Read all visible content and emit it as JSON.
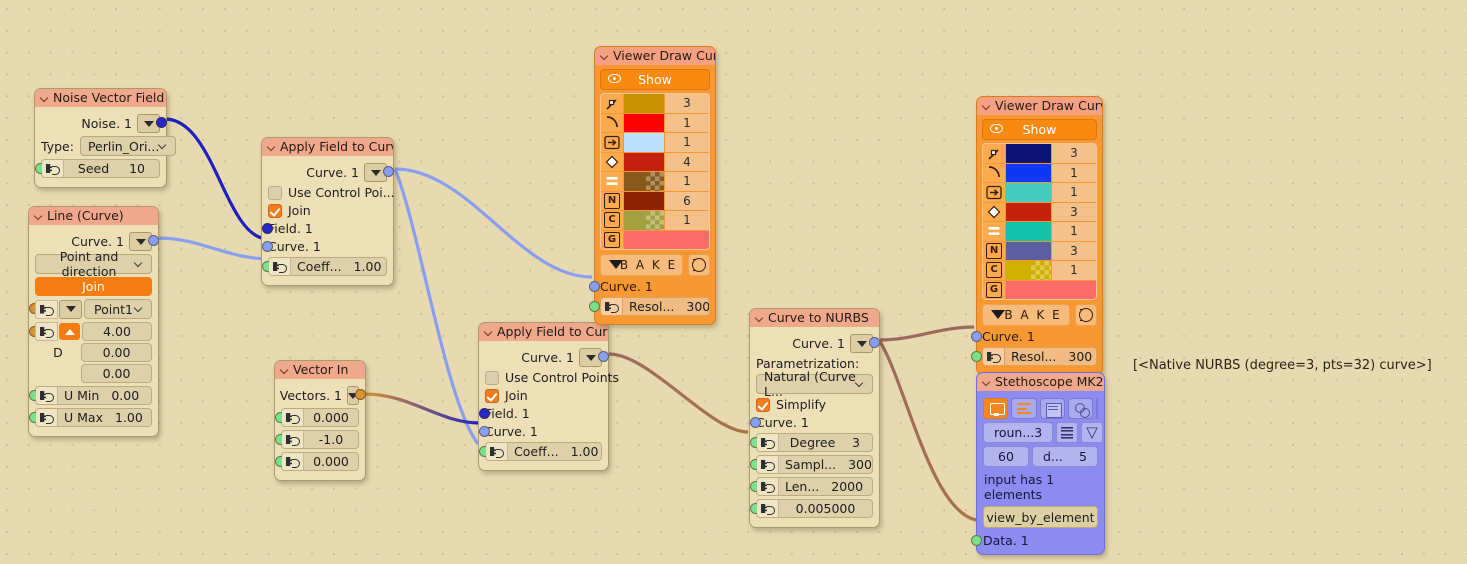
{
  "canvas": {
    "background_color": "#e8dab0",
    "annotation": "[<Native NURBS (degree=3, pts=32) curve>]"
  },
  "nodes": {
    "noise_vector_field": {
      "title": "Noise Vector Field",
      "output_label": "Noise. 1",
      "type_label": "Type:",
      "type_value": "Perlin_Ori...",
      "seed_label": "Seed",
      "seed_value": "10"
    },
    "line_curve": {
      "title": "Line (Curve)",
      "output_label": "Curve. 1",
      "mode_value": "Point and direction",
      "join_label": "Join",
      "point_value": "Point1",
      "dir_x": "4.00",
      "dir_label": "D",
      "dir_y": "0.00",
      "dir_z": "0.00",
      "umin_label": "U Min",
      "umin_value": "0.00",
      "umax_label": "U Max",
      "umax_value": "1.00"
    },
    "apply_field_top": {
      "title": "Apply Field to Curve",
      "output_label": "Curve. 1",
      "use_control_points_label": "Use Control Poi...",
      "use_control_points_checked": false,
      "join_label": "Join",
      "join_checked": true,
      "field_input": "Field. 1",
      "curve_input": "Curve. 1",
      "coeff_label": "Coeff...",
      "coeff_value": "1.00"
    },
    "apply_field_bottom": {
      "title": "Apply Field to Curve",
      "output_label": "Curve. 1",
      "use_control_points_label": "Use Control Points",
      "use_control_points_checked": false,
      "join_label": "Join",
      "join_checked": true,
      "field_input": "Field. 1",
      "curve_input": "Curve. 1",
      "coeff_label": "Coeff...",
      "coeff_value": "1.00"
    },
    "vector_in": {
      "title": "Vector In",
      "output_label": "Vectors. 1",
      "x_value": "0.000",
      "y_value": "-1.0",
      "z_value": "0.000"
    },
    "viewer_left": {
      "title": "Viewer Draw Curve",
      "show_label": "Show",
      "bake_label": "B A K E",
      "curve_input": "Curve. 1",
      "resolution_label": "Resol...",
      "resolution_value": "300",
      "rows": [
        {
          "icon": "vertex-icon",
          "color": "#c79000",
          "checker": false,
          "value": "3"
        },
        {
          "icon": "curve-icon",
          "color": "#fe0000",
          "checker": false,
          "value": "1"
        },
        {
          "icon": "arrow-icon",
          "color": "#bee0fa",
          "checker": false,
          "value": "1"
        },
        {
          "icon": "diamond-icon",
          "color": "#c32012",
          "checker": false,
          "value": "4"
        },
        {
          "icon": "equals-icon",
          "color": "#87591b",
          "checker": true,
          "value": "1"
        },
        {
          "icon": "N",
          "color": "#8d2205",
          "checker": false,
          "value": "6"
        },
        {
          "icon": "C",
          "color": "#a2a041",
          "checker": true,
          "value": "1"
        },
        {
          "icon": "G",
          "color": "#fd6a6a",
          "checker": false,
          "value": ""
        }
      ]
    },
    "viewer_right": {
      "title": "Viewer Draw Curve",
      "show_label": "Show",
      "bake_label": "B A K E",
      "curve_input": "Curve. 1",
      "resolution_label": "Resol...",
      "resolution_value": "300",
      "rows": [
        {
          "icon": "vertex-icon",
          "color": "#0b1473",
          "checker": false,
          "value": "3"
        },
        {
          "icon": "curve-icon",
          "color": "#1038f4",
          "checker": false,
          "value": "1"
        },
        {
          "icon": "arrow-icon",
          "color": "#46cbbc",
          "checker": false,
          "value": "1"
        },
        {
          "icon": "diamond-icon",
          "color": "#c42208",
          "checker": false,
          "value": "3"
        },
        {
          "icon": "equals-icon",
          "color": "#12c2a9",
          "checker": false,
          "value": "1"
        },
        {
          "icon": "N",
          "color": "#5d5d9f",
          "checker": false,
          "value": "3"
        },
        {
          "icon": "C",
          "color": "#cfb200",
          "checker": true,
          "value": "1"
        },
        {
          "icon": "G",
          "color": "#fd6a6a",
          "checker": false,
          "value": ""
        }
      ]
    },
    "curve_to_nurbs": {
      "title": "Curve to NURBS",
      "output_label": "Curve. 1",
      "parametrization_label": "Parametrization:",
      "parametrization_value": "Natural (Curve L...",
      "simplify_label": "Simplify",
      "simplify_checked": true,
      "curve_input": "Curve. 1",
      "degree_label": "Degree",
      "degree_value": "3",
      "samples_label": "Sampl...",
      "samples_value": "300",
      "length_label": "Len...",
      "length_value": "2000",
      "tolerance_value": "0.005000"
    },
    "stethoscope": {
      "title": "Stethoscope MK2",
      "swatch_color": "#3c3a3a",
      "round_label": "roun...",
      "round_value": "3",
      "num_value": "60",
      "depth_label": "d...",
      "depth_value": "5",
      "status_text": "input has 1 elements",
      "mode_button": "view_by_element",
      "data_input": "Data. 1"
    }
  }
}
